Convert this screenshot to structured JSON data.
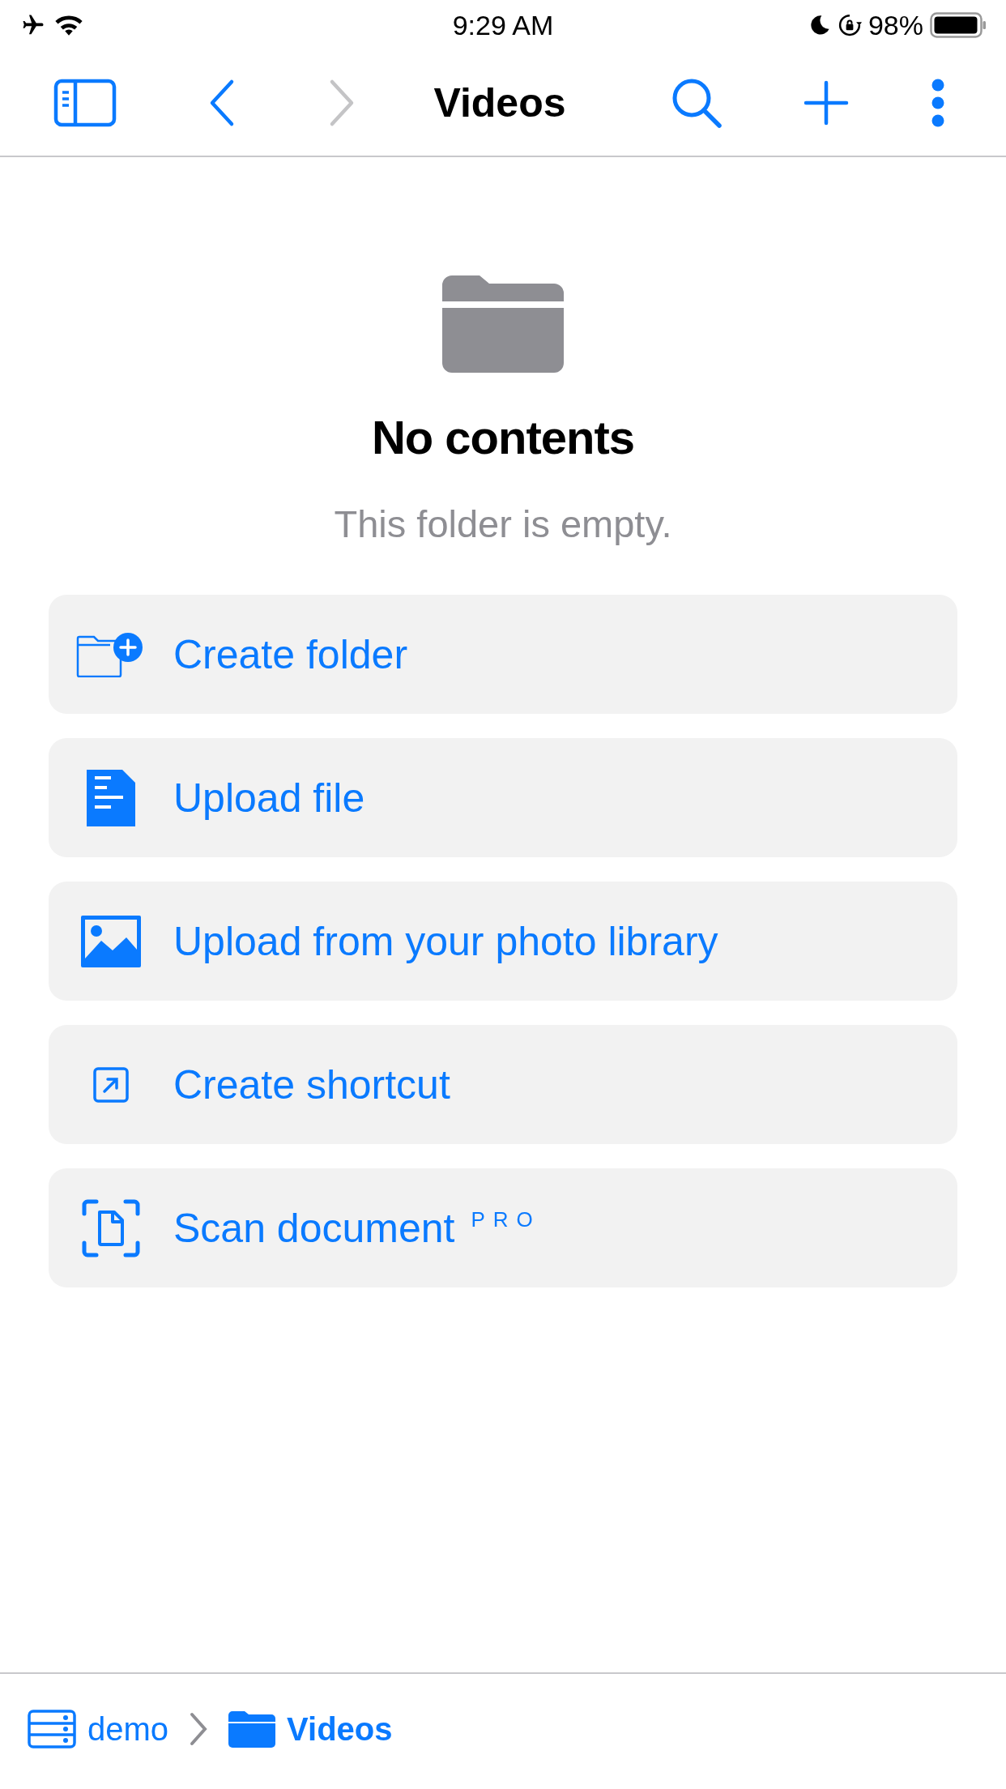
{
  "status_bar": {
    "time": "9:29 AM",
    "battery": "98%"
  },
  "toolbar": [
    {
      "kind": "sidebar",
      "disabled": false
    },
    {
      "kind": "back",
      "disabled": false
    },
    {
      "kind": "forward",
      "disabled": true
    }
  ],
  "title": "Videos",
  "toolbar_right": [
    {
      "kind": "search"
    },
    {
      "kind": "add"
    },
    {
      "kind": "more"
    }
  ],
  "empty_state": {
    "heading": "No contents",
    "message": "This folder is empty."
  },
  "actions": [
    {
      "kind": "folder",
      "label": "Create folder"
    },
    {
      "kind": "file",
      "label": "Upload file"
    },
    {
      "kind": "photo",
      "label": "Upload from your photo library"
    },
    {
      "kind": "shortcut",
      "label": "Create shortcut"
    },
    {
      "kind": "scan",
      "label": "Scan document",
      "badge": "PRO"
    }
  ],
  "breadcrumb": [
    {
      "kind": "server",
      "label": "demo",
      "selected": false
    },
    {
      "kind": "folder",
      "label": "Videos",
      "selected": true
    }
  ]
}
